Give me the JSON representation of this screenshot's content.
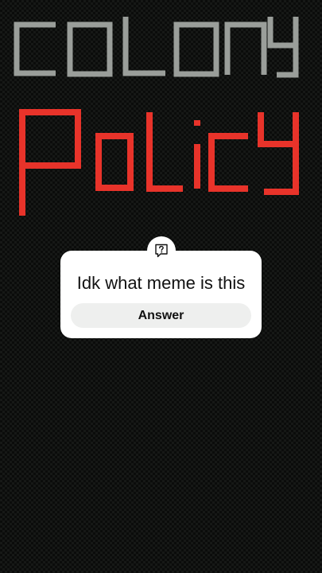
{
  "title": {
    "line1": "COLONY",
    "line2": "POLICY",
    "line1_color": "#9a9e9a",
    "line2_color": "#e8332a"
  },
  "question_sticker": {
    "icon": "question-bubble-icon",
    "question": "Idk what meme is this",
    "answer_label": "Answer"
  },
  "colors": {
    "background": "#0b0c0b",
    "sticker_background": "#ffffff",
    "answer_button_background": "#eeefee"
  }
}
